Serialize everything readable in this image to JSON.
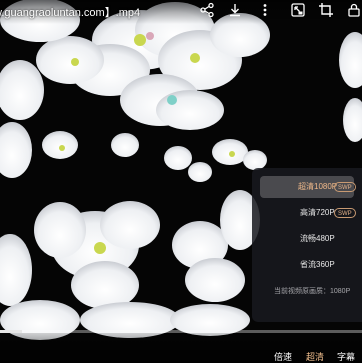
{
  "video": {
    "title": "w.guangraoluntan.com】.mp4"
  },
  "top_icons": [
    "share-icon",
    "download-icon",
    "more-icon",
    "picture-in-picture-icon",
    "crop-icon",
    "lock-icon"
  ],
  "quality_menu": {
    "options": [
      {
        "label": "超清1080P",
        "badge": "SWP",
        "selected": true
      },
      {
        "label": "高清720P",
        "badge": "SWP",
        "selected": false
      },
      {
        "label": "流畅480P",
        "badge": "",
        "selected": false
      },
      {
        "label": "省流360P",
        "badge": "",
        "selected": false
      }
    ],
    "current_note": "当前视频原画质：1080P"
  },
  "progress": {
    "fraction": 0.06
  },
  "bottom_controls": {
    "speed_label": "倍速",
    "quality_label": "超清",
    "subtitle_label": "字幕"
  },
  "colors": {
    "accent": "#f3c08f",
    "menu_bg": "#181a20",
    "badge_border": "#c89a72"
  }
}
